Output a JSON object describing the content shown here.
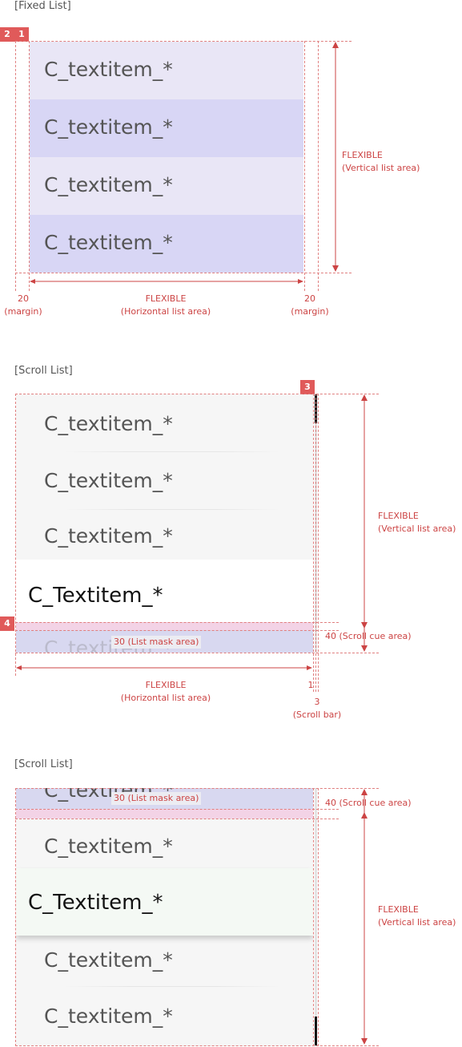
{
  "sections": [
    {
      "title": "[Fixed List]"
    },
    {
      "title": "[Scroll List]"
    },
    {
      "title": "[Scroll List]"
    }
  ],
  "item_label": "C_textitem_*",
  "focused_item_label": "C_Textitem_*",
  "badges": [
    "2",
    "1",
    "3",
    "4"
  ],
  "annotations": {
    "margin_value": "20",
    "margin_label": "(margin)",
    "flexible": "FLEXIBLE",
    "horizontal_list_area": "(Horizontal list area)",
    "vertical_list_area": "(Vertical list area)",
    "list_mask_area": "30 (List mask area)",
    "scroll_cue_area": "40 (Scroll cue area)",
    "one": "1",
    "scroll_bar_value": "3",
    "scroll_bar_label": "(Scroll bar)"
  },
  "colors": {
    "row_light": "#e9e6f6",
    "row_dark": "#d8d6f5",
    "scroll_bg": "#f6f6f6",
    "focus_bg": "#ffffff",
    "focus_bg_green": "#f4f9f4",
    "mask": "#d8d8f0",
    "cue": "#f3d3e6",
    "annotation": "#cc4444",
    "scrollbar_thumb": "#111111"
  }
}
